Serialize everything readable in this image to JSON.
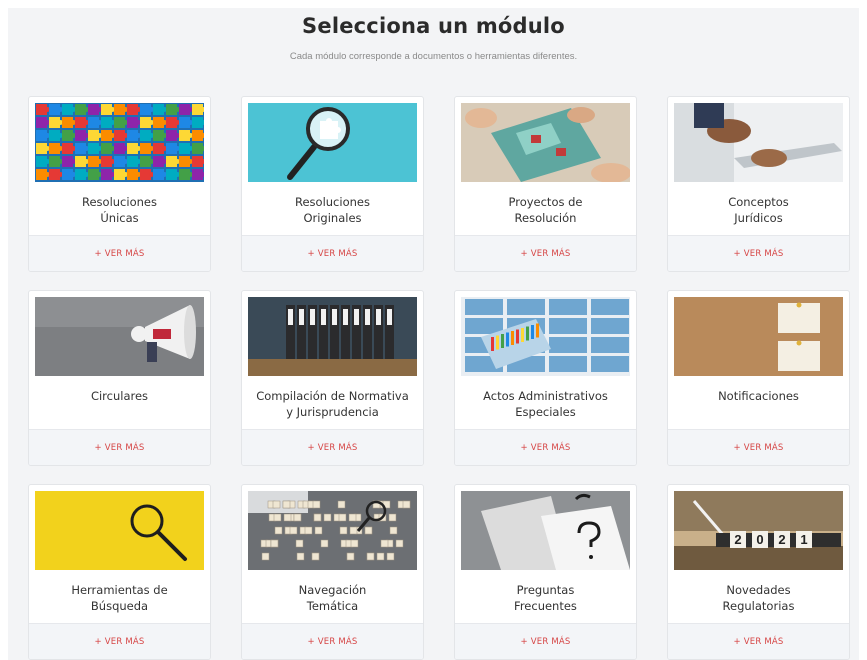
{
  "header": {
    "title": "Selecciona un módulo",
    "subtitle": "Cada módulo corresponde a documentos o herramientas diferentes."
  },
  "accent_color": "#d64545",
  "modules": [
    {
      "line1": "Resoluciones",
      "line2": "Únicas",
      "link": "+ VER MÁS",
      "image": "puzzle-pieces-image"
    },
    {
      "line1": "Resoluciones",
      "line2": "Originales",
      "link": "+ VER MÁS",
      "image": "magnifier-puzzle-image"
    },
    {
      "line1": "Proyectos de",
      "line2": "Resolución",
      "link": "+ VER MÁS",
      "image": "hands-puzzle-image"
    },
    {
      "line1": "Conceptos",
      "line2": "Jurídicos",
      "link": "+ VER MÁS",
      "image": "tablet-hands-image"
    },
    {
      "line1": "Circulares",
      "line2": "",
      "link": "+ VER MÁS",
      "image": "megaphone-image"
    },
    {
      "line1": "Compilación de Normativa",
      "line2": "y Jurisprudencia",
      "link": "+ VER MÁS",
      "image": "binders-image"
    },
    {
      "line1": "Actos Administrativos",
      "line2": "Especiales",
      "link": "+ VER MÁS",
      "image": "file-drawers-image"
    },
    {
      "line1": "Notificaciones",
      "line2": "",
      "link": "+ VER MÁS",
      "image": "cork-board-image"
    },
    {
      "line1": "Herramientas de",
      "line2": "Búsqueda",
      "link": "+ VER MÁS",
      "image": "magnifier-yellow-image"
    },
    {
      "line1": "Navegación",
      "line2": "Temática",
      "link": "+ VER MÁS",
      "image": "letter-tiles-image"
    },
    {
      "line1": "Preguntas",
      "line2": "Frecuentes",
      "link": "+ VER MÁS",
      "image": "question-cards-image"
    },
    {
      "line1": "Novedades",
      "line2": "Regulatorias",
      "link": "+ VER MÁS",
      "image": "year-blocks-image"
    }
  ],
  "year_blocks": [
    "2",
    "0",
    "2",
    "1"
  ]
}
